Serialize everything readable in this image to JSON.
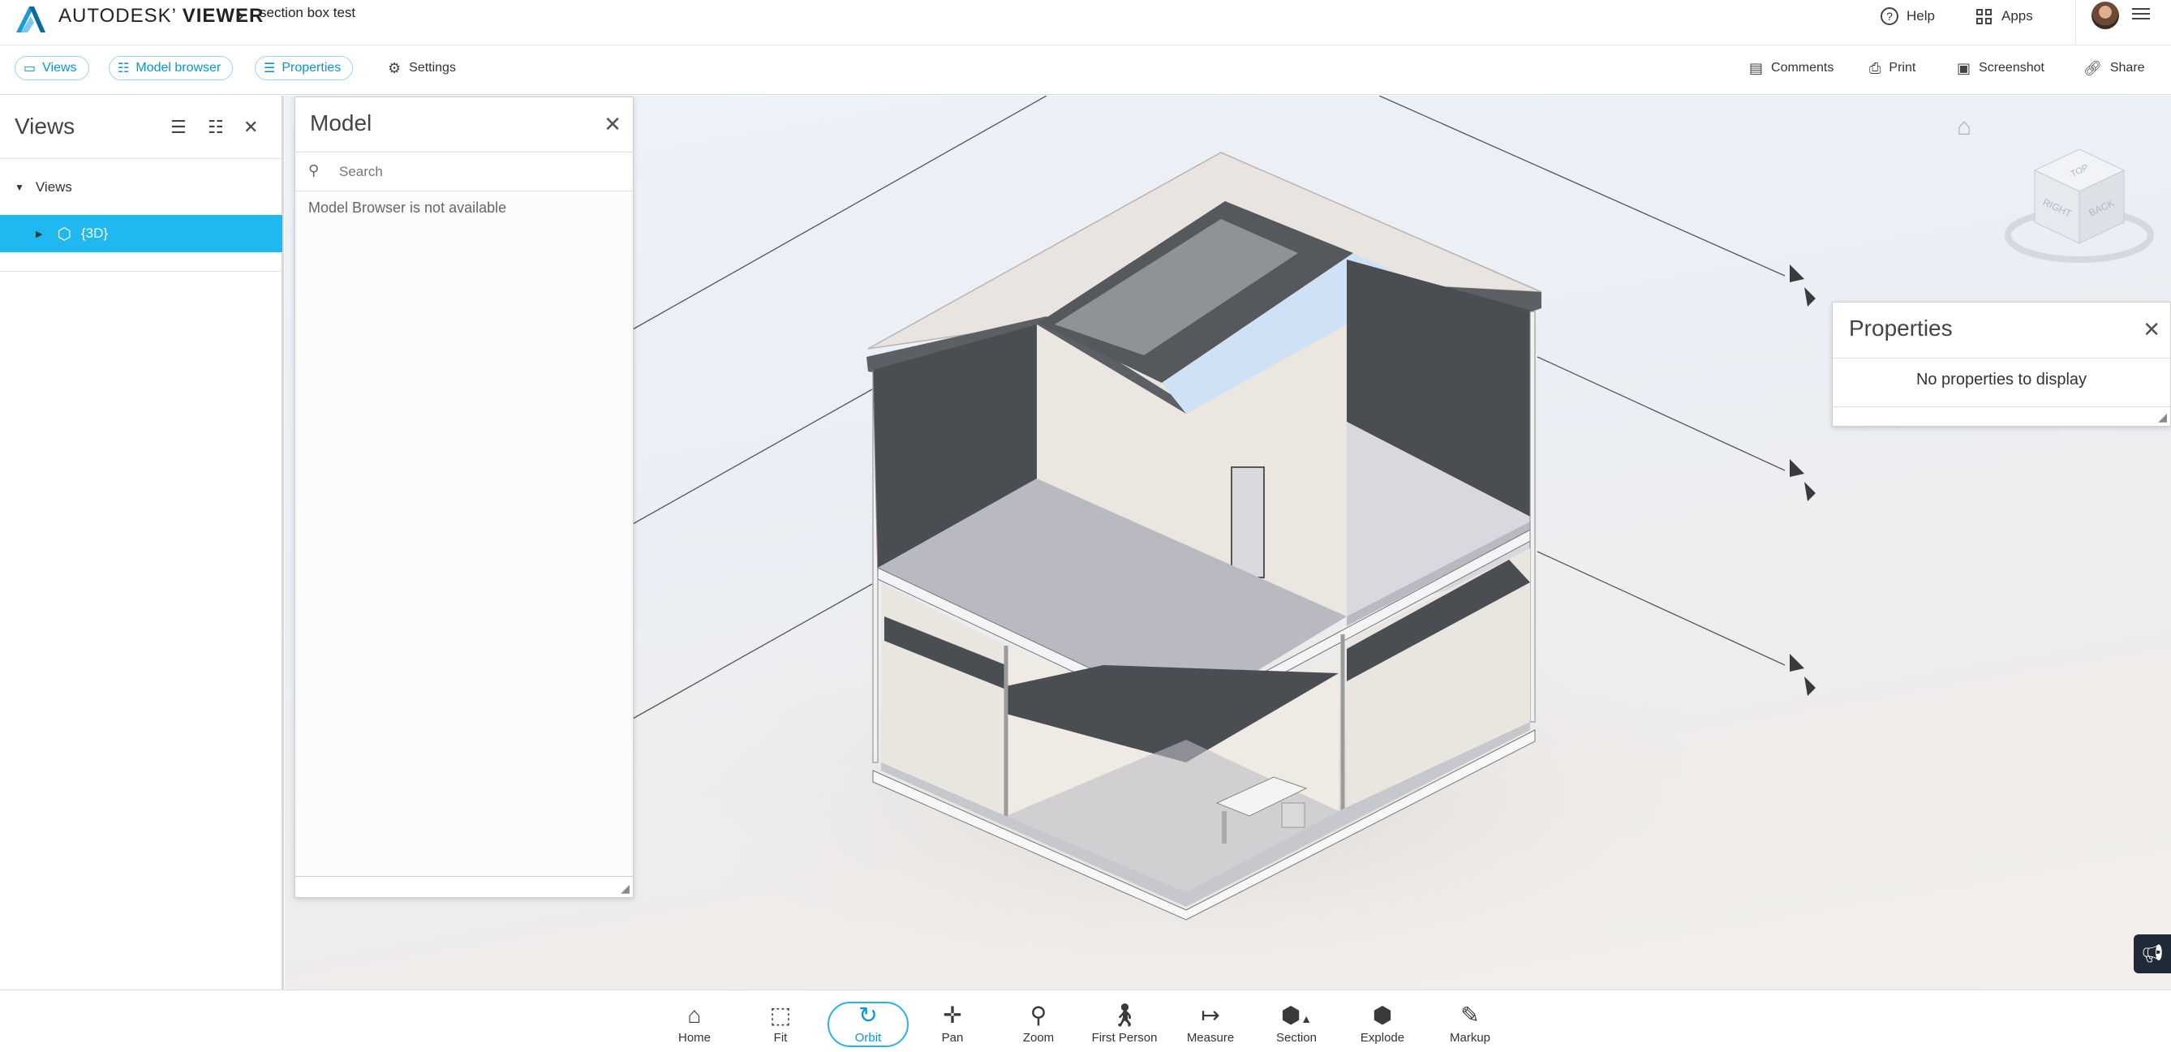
{
  "app": {
    "brand_prefix": "AUTODESK",
    "brand_suffix": "VIEWER",
    "doc_title": "section box test",
    "help_label": "Help",
    "apps_label": "Apps"
  },
  "toolbar": {
    "views_label": "Views",
    "model_browser_label": "Model browser",
    "properties_label": "Properties",
    "settings_label": "Settings",
    "comments_label": "Comments",
    "print_label": "Print",
    "screenshot_label": "Screenshot",
    "share_label": "Share"
  },
  "views_panel": {
    "title": "Views",
    "section_label": "Views",
    "items": [
      {
        "label": "{3D}"
      }
    ]
  },
  "model_panel": {
    "title": "Model",
    "search_placeholder": "Search",
    "message": "Model Browser is not available"
  },
  "properties_panel": {
    "title": "Properties",
    "message": "No properties to display"
  },
  "viewcube": {
    "faces": [
      "TOP",
      "RIGHT",
      "BACK"
    ]
  },
  "bottom_tools": [
    {
      "label": "Home",
      "icon": "home-icon"
    },
    {
      "label": "Fit",
      "icon": "fit-icon"
    },
    {
      "label": "Orbit",
      "icon": "orbit-icon",
      "active": true
    },
    {
      "label": "Pan",
      "icon": "pan-icon"
    },
    {
      "label": "Zoom",
      "icon": "zoom-icon"
    },
    {
      "label": "First Person",
      "icon": "first-person-icon"
    },
    {
      "label": "Measure",
      "icon": "measure-icon"
    },
    {
      "label": "Section",
      "icon": "section-icon"
    },
    {
      "label": "Explode",
      "icon": "explode-icon"
    },
    {
      "label": "Markup",
      "icon": "markup-icon"
    }
  ],
  "colors": {
    "accent": "#0696d7",
    "selected_row": "#1fb8f0",
    "brand_logo": "#1a9ad6"
  }
}
